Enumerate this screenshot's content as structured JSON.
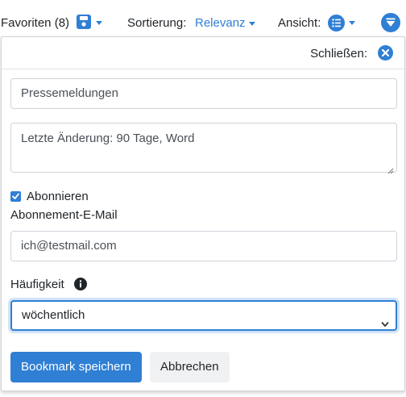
{
  "toolbar": {
    "favorites_label": "Favoriten (8)",
    "sort_label": "Sortierung:",
    "sort_value": "Relevanz",
    "view_label": "Ansicht:"
  },
  "panel": {
    "close_label": "Schließen:",
    "title_value": "Pressemeldungen",
    "description_value": "Letzte Änderung: 90 Tage, Word",
    "subscribe_label": "Abonnieren",
    "subscribe_checked": true,
    "email_label": "Abonnement-E-Mail",
    "email_value": "ich@testmail.com",
    "frequency_label": "Häufigkeit",
    "frequency_value": "wöchentlich",
    "save_button": "Bookmark speichern",
    "cancel_button": "Abbrechen"
  },
  "colors": {
    "accent": "#2f7fd4",
    "border": "#ced4da"
  }
}
